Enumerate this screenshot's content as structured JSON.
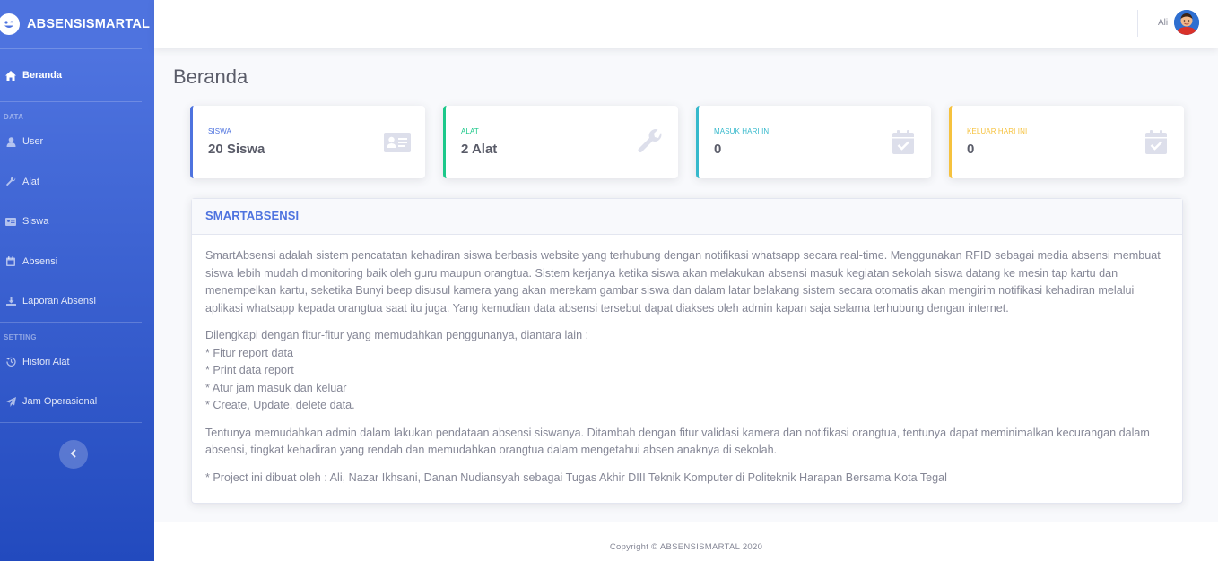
{
  "brand": {
    "name": "ABSENSISMARTAL"
  },
  "sidebar": {
    "main": [
      {
        "label": "Beranda",
        "icon": "home-icon"
      }
    ],
    "heading_data": "DATA",
    "data_items": [
      {
        "label": "User",
        "icon": "user-icon"
      },
      {
        "label": "Alat",
        "icon": "wrench-icon"
      },
      {
        "label": "Siswa",
        "icon": "id-card-icon"
      },
      {
        "label": "Absensi",
        "icon": "calendar-icon"
      },
      {
        "label": "Laporan Absensi",
        "icon": "download-icon"
      }
    ],
    "heading_setting": "SETTING",
    "setting_items": [
      {
        "label": "Histori Alat",
        "icon": "history-icon"
      },
      {
        "label": "Jam Operasional",
        "icon": "paper-plane-icon"
      }
    ],
    "toggle": "chevron-left-icon"
  },
  "topbar": {
    "username": "Ali"
  },
  "page": {
    "title": "Beranda"
  },
  "cards": [
    {
      "label": "SISWA",
      "value": "20 Siswa",
      "color": "#4e73df",
      "icon": "id-card-icon"
    },
    {
      "label": "ALAT",
      "value": "2 Alat",
      "color": "#1cc88a",
      "icon": "wrench-icon"
    },
    {
      "label": "MASUK HARI INI",
      "value": "0",
      "color": "#36b9cc",
      "icon": "calendar-check-icon"
    },
    {
      "label": "KELUAR HARI INI",
      "value": "0",
      "color": "#f6c23e",
      "icon": "calendar-check-icon"
    }
  ],
  "panel": {
    "title": "SMARTABSENSI",
    "paragraph1": "SmartAbsensi adalah sistem pencatatan kehadiran siswa berbasis website yang terhubung dengan notifikasi whatsapp secara real-time. Menggunakan RFID sebagai media absensi membuat siswa lebih mudah dimonitoring baik oleh guru maupun orangtua. Sistem kerjanya ketika siswa akan melakukan absensi masuk kegiatan sekolah siswa datang ke mesin tap kartu dan menempelkan kartu, seketika Bunyi beep disusul kamera yang akan merekam gambar siswa dan dalam latar belakang sistem secara otomatis akan mengirim notifikasi kehadiran melalui aplikasi whatsapp kepada orangtua saat itu juga. Yang kemudian data absensi tersebut dapat diakses oleh admin kapan saja selama terhubung dengan internet.",
    "features_intro": "Dilengkapi dengan fitur-fitur yang memudahkan penggunanya, diantara lain :",
    "features": [
      "* Fitur report data",
      "* Print data report",
      "* Atur jam masuk dan keluar",
      "* Create, Update, delete data."
    ],
    "paragraph3": "Tentunya memudahkan admin dalam lakukan pendataan absensi siswanya. Ditambah dengan fitur validasi kamera dan notifikasi orangtua, tentunya dapat meminimalkan kecurangan dalam absensi, tingkat kehadiran yang rendah dan memudahkan orangtua dalam mengetahui absen anaknya di sekolah.",
    "credit": "* Project ini dibuat oleh : Ali, Nazar Ikhsani, Danan Nudiansyah sebagai Tugas Akhir DIII Teknik Komputer di Politeknik Harapan Bersama Kota Tegal"
  },
  "footer": {
    "copyright": "Copyright © ABSENSISMARTAL 2020"
  }
}
